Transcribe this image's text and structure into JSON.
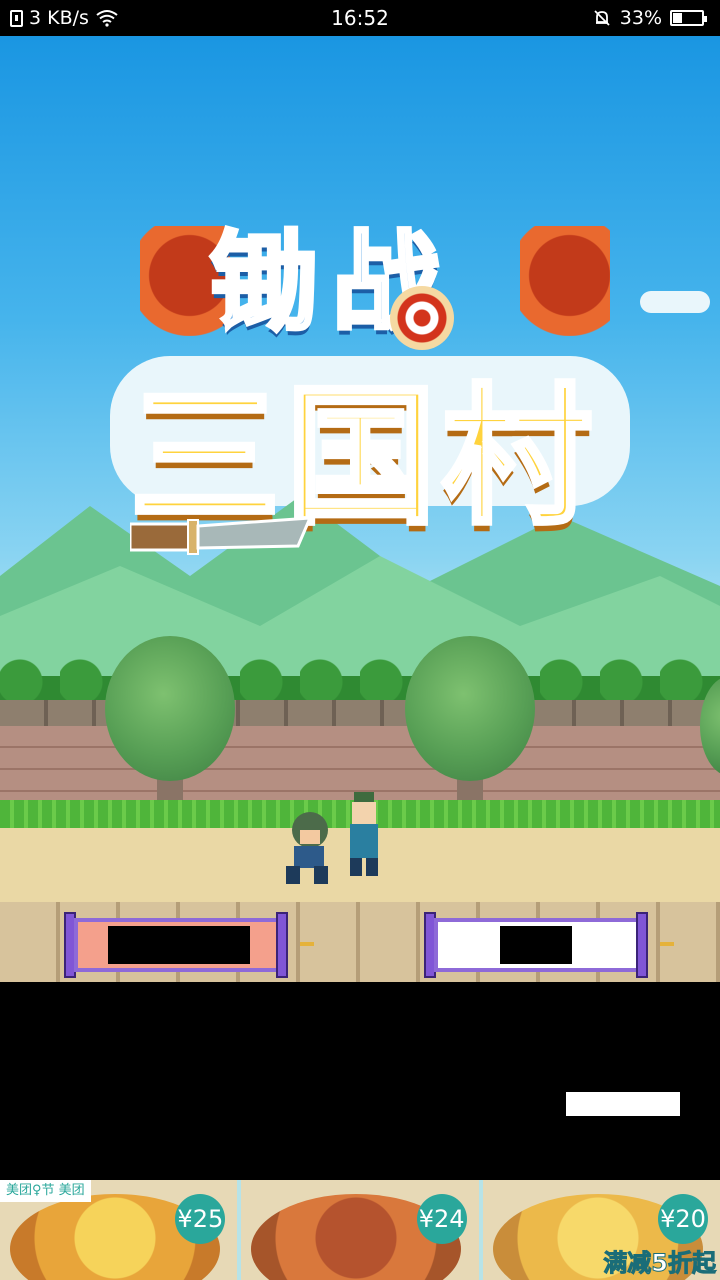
{
  "status_bar": {
    "speed": "3 KB/s",
    "time": "16:52",
    "battery_percent": "33%",
    "battery_level": 0.33
  },
  "game": {
    "title_line1": "锄战",
    "title_line2": "三国村"
  },
  "scrolls": [
    {
      "value": "████",
      "fill_color": "#f4a08c"
    },
    {
      "value": "██",
      "fill_color": "#ffffff"
    }
  ],
  "redacted_text": "███ ████",
  "ad": {
    "brand": "美团♀节 美团",
    "items": [
      {
        "price": "¥25"
      },
      {
        "price": "¥24"
      },
      {
        "price": "¥20"
      }
    ],
    "promo": "满减5折起"
  }
}
